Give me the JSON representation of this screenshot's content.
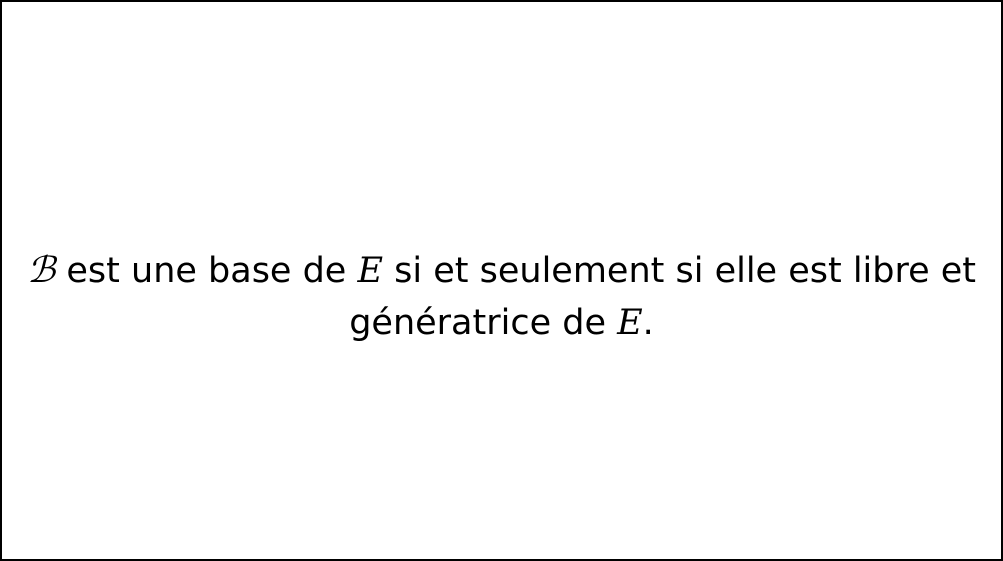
{
  "statement": {
    "line1": {
      "symbol_basis": "ℬ",
      "text_a": " est une base de ",
      "symbol_space": "E",
      "text_b": " si et seulement si elle est libre et"
    },
    "line2": {
      "text_a": "génératrice de ",
      "symbol_space": "E",
      "text_b": "."
    }
  }
}
